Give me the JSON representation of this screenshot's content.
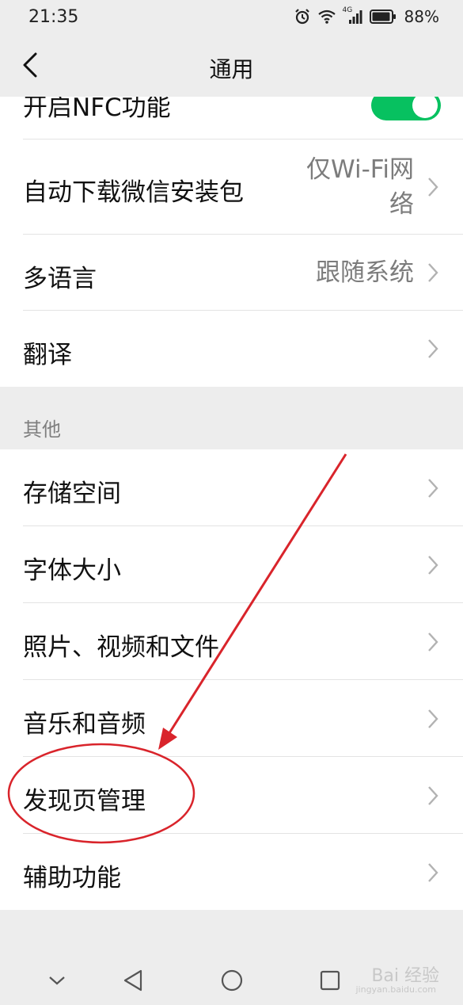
{
  "status_bar": {
    "time": "21:35",
    "network": "4G",
    "battery_percent": "88%"
  },
  "nav": {
    "title": "通用",
    "back_icon": "chevron-left-icon"
  },
  "settings": {
    "nfc_label": "开启NFC功能",
    "nfc_enabled": true,
    "rows_top": [
      {
        "label": "自动下载微信安装包",
        "value_line1": "仅Wi-Fi网",
        "value_line2": "络"
      },
      {
        "label": "多语言",
        "value": "跟随系统"
      },
      {
        "label": "翻译",
        "value": ""
      }
    ],
    "section_other": "其他",
    "rows_other": [
      {
        "label": "存储空间"
      },
      {
        "label": "字体大小"
      },
      {
        "label": "照片、视频和文件"
      },
      {
        "label": "音乐和音频"
      },
      {
        "label": "发现页管理"
      },
      {
        "label": "辅助功能"
      }
    ]
  },
  "system_nav": {
    "buttons": [
      "chevron-down-icon",
      "back-triangle-icon",
      "home-circle-icon",
      "recents-square-icon"
    ]
  },
  "watermark": {
    "text": "Bai 经验",
    "sub": "jingyan.baidu.com"
  },
  "colors": {
    "toggle_on": "#07c160",
    "annotation": "#d9242b",
    "background": "#ededed"
  }
}
